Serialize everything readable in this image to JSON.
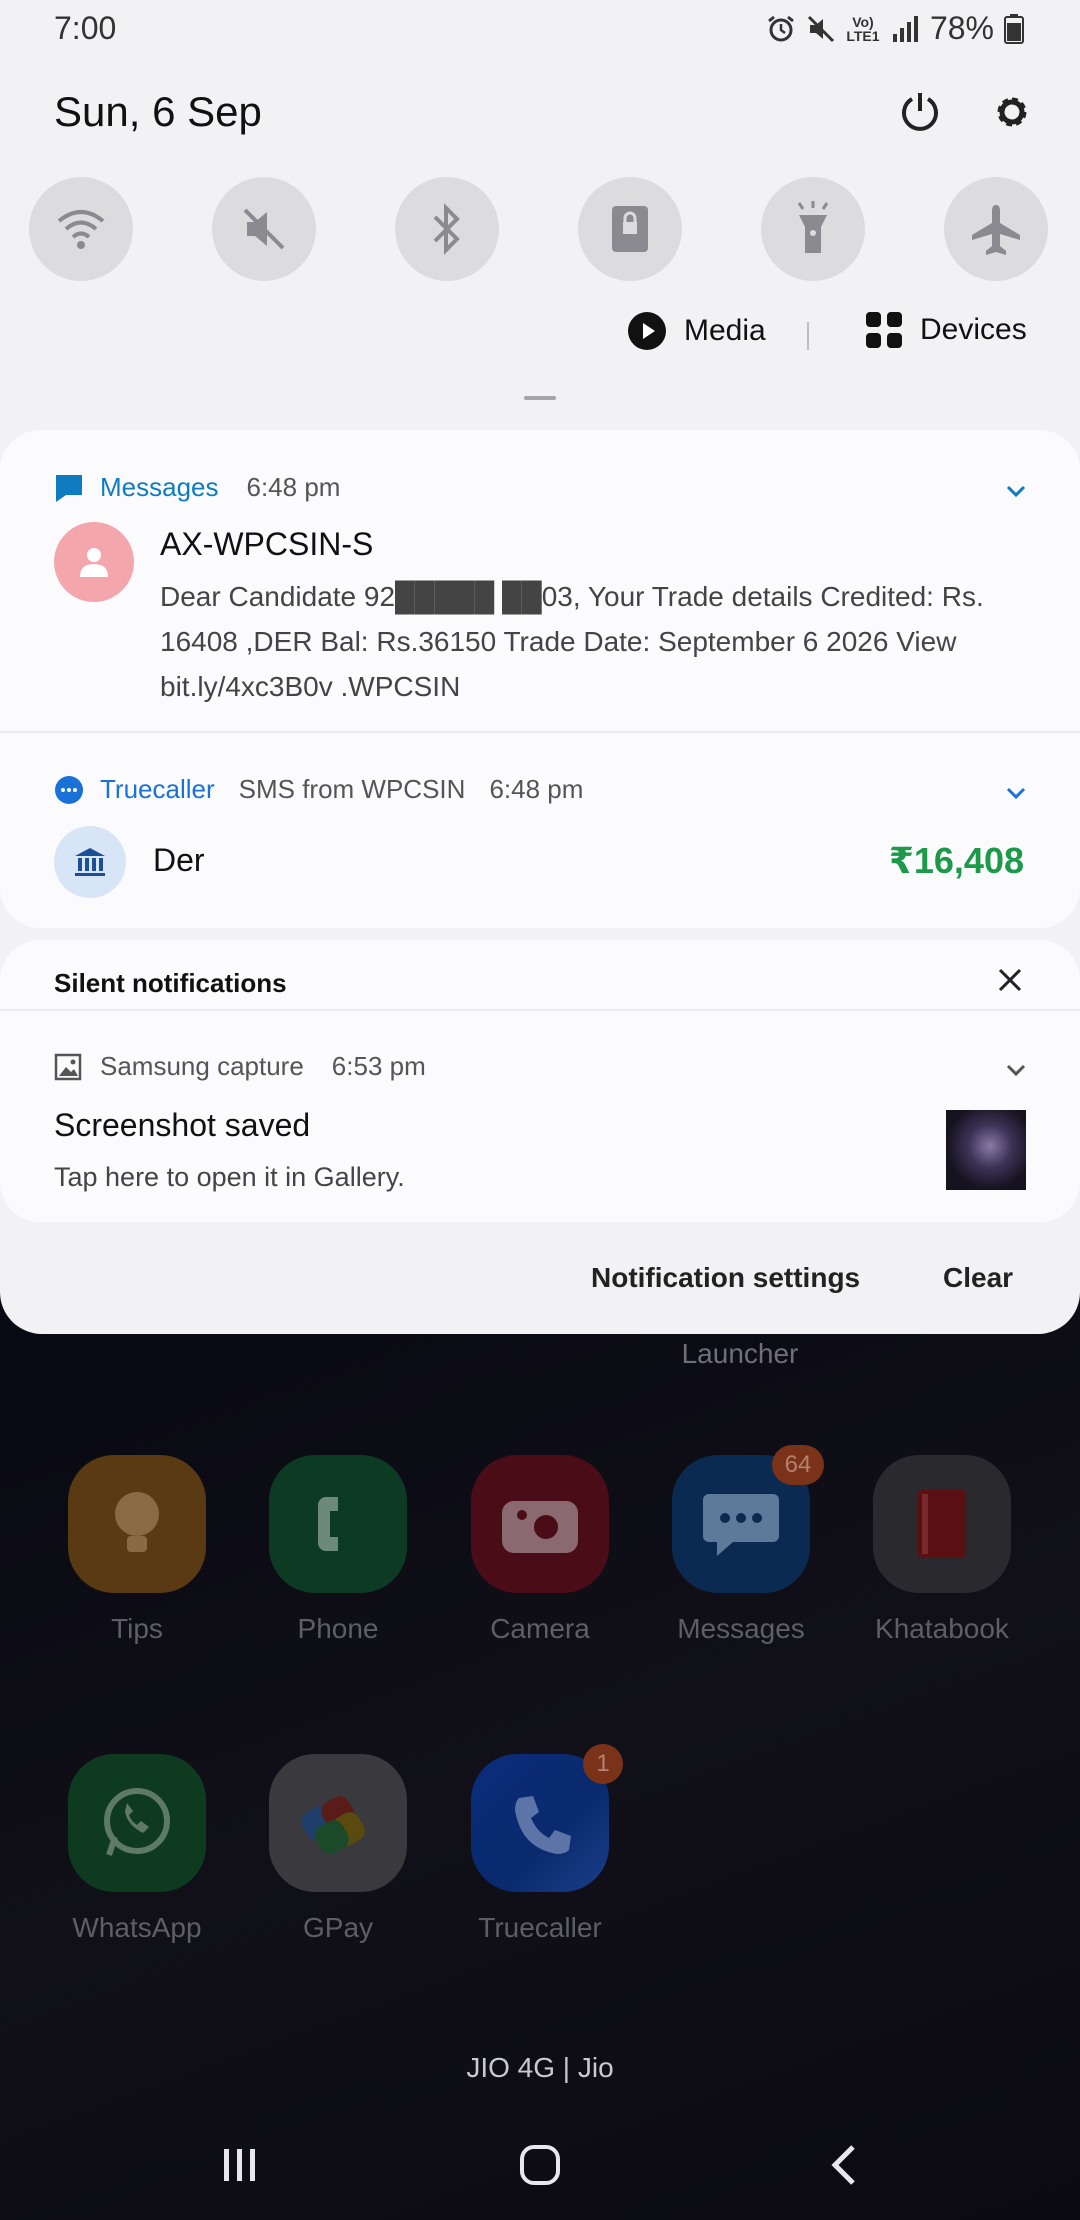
{
  "status_bar": {
    "time": "7:00",
    "battery": "78%",
    "network_label": "Vo) LTE1"
  },
  "header": {
    "date": "Sun, 6 Sep"
  },
  "quick_settings": [
    {
      "name": "wifi",
      "icon": "wifi-icon"
    },
    {
      "name": "sound",
      "icon": "mute-icon"
    },
    {
      "name": "bluetooth",
      "icon": "bluetooth-icon"
    },
    {
      "name": "rotation-lock",
      "icon": "lock-icon"
    },
    {
      "name": "flashlight",
      "icon": "flashlight-icon"
    },
    {
      "name": "airplane",
      "icon": "airplane-icon"
    }
  ],
  "media_row": {
    "media_label": "Media",
    "devices_label": "Devices"
  },
  "notifications": {
    "messages": {
      "app": "Messages",
      "time": "6:48 pm",
      "sender": "AX-WPCSIN-S",
      "line1": "Dear Candidate 92█████ ██03, Your Trade details Credited: Rs.",
      "line2": "16408 ,DER Bal: Rs.36150 Trade Date: September 6 2026 View",
      "line3": "bit.ly/4xc3B0v .WPCSIN",
      "accent": "#0f7cc1"
    },
    "truecaller": {
      "app": "Truecaller",
      "subtitle": "SMS from WPCSIN",
      "time": "6:48 pm",
      "name": "Der",
      "amount": "₹16,408",
      "accent": "#1a72d8",
      "amount_color": "#1c9a4a"
    }
  },
  "silent": {
    "title": "Silent notifications",
    "capture": {
      "app": "Samsung capture",
      "time": "6:53 pm",
      "title": "Screenshot saved",
      "body": "Tap here to open it in Gallery."
    }
  },
  "footer": {
    "settings_label": "Notification settings",
    "clear_label": "Clear"
  },
  "home": {
    "launcher_label": "Launcher",
    "apps_row1": [
      {
        "label": "Tips",
        "badge": ""
      },
      {
        "label": "Phone",
        "badge": ""
      },
      {
        "label": "Camera",
        "badge": ""
      },
      {
        "label": "Messages",
        "badge": "64"
      },
      {
        "label": "Khatabook",
        "badge": ""
      }
    ],
    "apps_row2": [
      {
        "label": "WhatsApp",
        "badge": ""
      },
      {
        "label": "GPay",
        "badge": ""
      },
      {
        "label": "Truecaller",
        "badge": "1"
      }
    ],
    "carrier": "JIO 4G | Jio"
  }
}
